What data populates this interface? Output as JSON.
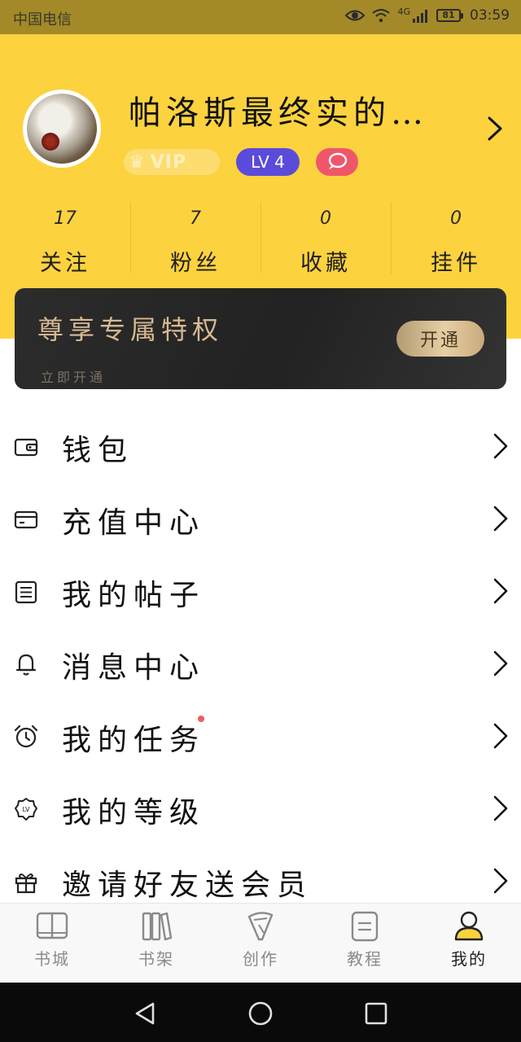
{
  "status_bar": {
    "carrier": "中国电信",
    "network": "4G",
    "battery": "81",
    "time": "03:59"
  },
  "profile": {
    "nickname": "帕洛斯最终实的…",
    "vip_label": "VIP",
    "level_label": "LV 4"
  },
  "stats": [
    {
      "count": "17",
      "label": "关注"
    },
    {
      "count": "7",
      "label": "粉丝"
    },
    {
      "count": "0",
      "label": "收藏"
    },
    {
      "count": "0",
      "label": "挂件"
    }
  ],
  "vip_banner": {
    "title": "尊享专属特权",
    "subtitle": "立即开通",
    "button": "开通"
  },
  "menu": [
    {
      "label": "钱包",
      "icon": "wallet-icon"
    },
    {
      "label": "充值中心",
      "icon": "card-icon"
    },
    {
      "label": "我的帖子",
      "icon": "document-icon"
    },
    {
      "label": "消息中心",
      "icon": "bell-icon"
    },
    {
      "label": "我的任务",
      "icon": "alarm-clock-icon",
      "has_dot": true
    },
    {
      "label": "我的等级",
      "icon": "level-badge-icon"
    },
    {
      "label": "邀请好友送会员",
      "icon": "gift-icon"
    }
  ],
  "tabs": [
    {
      "label": "书城",
      "icon": "book-open-icon"
    },
    {
      "label": "书架",
      "icon": "bookshelf-icon"
    },
    {
      "label": "创作",
      "icon": "quill-icon"
    },
    {
      "label": "教程",
      "icon": "tutorial-icon"
    },
    {
      "label": "我的",
      "icon": "user-icon",
      "active": true
    }
  ],
  "colors": {
    "header_yellow": "#fcd23f",
    "level_badge": "#5b4bdb",
    "chat_badge": "#f0566a",
    "banner_dark": "#262626",
    "banner_gold": "#d7b992",
    "notify_dot": "#f05b5b"
  }
}
